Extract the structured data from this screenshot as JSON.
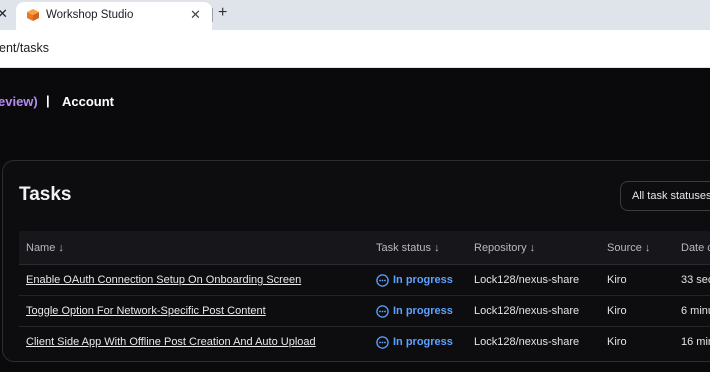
{
  "browser": {
    "tab_title": "Workshop Studio",
    "tab_close": "✕",
    "new_tab": "+",
    "edge_close": "✕",
    "url": "ent/tasks"
  },
  "nav": {
    "preview_link": "eview)",
    "separator": "|",
    "account_link": "Account"
  },
  "card": {
    "title": "Tasks",
    "status_filter": "All task statuses"
  },
  "table": {
    "headers": {
      "name": "Name ↓",
      "task_status": "Task status ↓",
      "repository": "Repository ↓",
      "source": "Source ↓",
      "date": "Date c"
    },
    "rows": [
      {
        "name": "Enable OAuth Connection Setup On Onboarding Screen",
        "status": "In progress",
        "repository": "Lock128/nexus-share",
        "source": "Kiro",
        "date": "33 sec"
      },
      {
        "name": "Toggle Option For Network-Specific Post Content",
        "status": "In progress",
        "repository": "Lock128/nexus-share",
        "source": "Kiro",
        "date": "6 minu"
      },
      {
        "name": "Client Side App With Offline Post Creation And Auto Upload",
        "status": "In progress",
        "repository": "Lock128/nexus-share",
        "source": "Kiro",
        "date": "16 min"
      }
    ]
  },
  "colors": {
    "accent_purple": "#b48cf2",
    "status_blue": "#5da2ff",
    "background": "#0a0a0d"
  }
}
